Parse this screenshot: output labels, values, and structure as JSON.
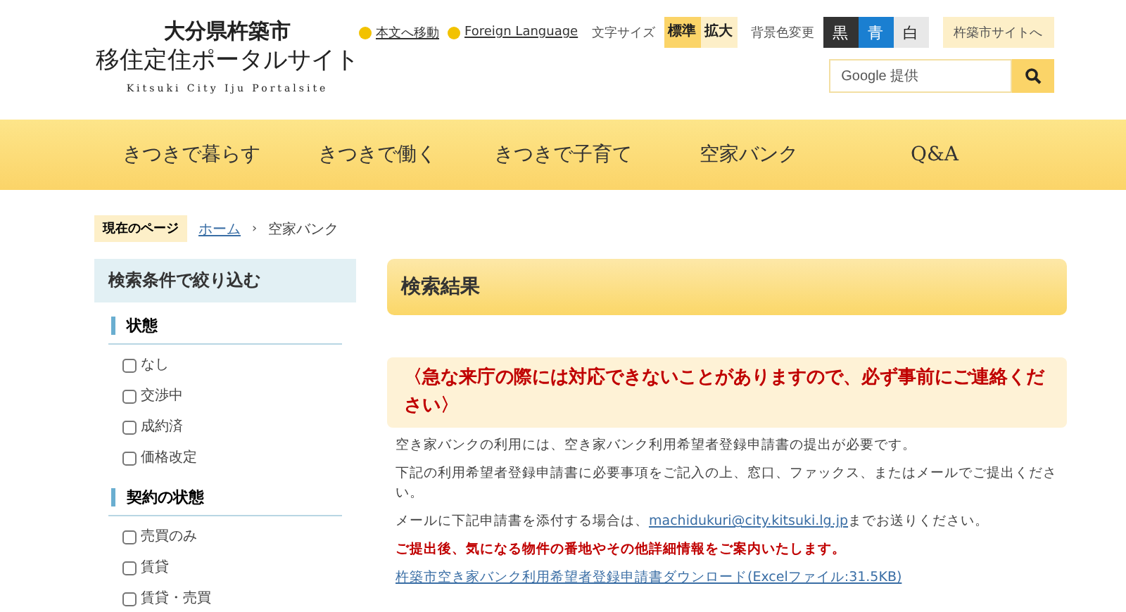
{
  "logo": {
    "prefecture": "大分県杵築市",
    "title": "移住定住ポータルサイト",
    "subtitle": "Kitsuki City Iju Portalsite"
  },
  "utility_links": [
    "本文へ移動",
    "Foreign Language"
  ],
  "font_size": {
    "label": "文字サイズ",
    "options": [
      {
        "label": "標準",
        "selected": true
      },
      {
        "label": "拡大",
        "selected": false
      }
    ]
  },
  "background_color": {
    "label": "背景色変更",
    "options": [
      {
        "label": "黒",
        "color": "#333333"
      },
      {
        "label": "青",
        "color": "#1a7fd1"
      },
      {
        "label": "白",
        "color": "#e8e8e8"
      }
    ]
  },
  "city_site_button": "杵築市サイトへ",
  "search": {
    "placeholder": "Google 提供"
  },
  "nav": [
    "きつきで暮らす",
    "きつきで働く",
    "きつきで子育て",
    "空家バンク",
    "Q&A"
  ],
  "breadcrumb": {
    "label": "現在のページ",
    "separator": "›",
    "items": [
      {
        "text": "ホーム",
        "link": true
      },
      {
        "text": "空家バンク",
        "link": false
      }
    ]
  },
  "sidebar": {
    "title": "検索条件で絞り込む",
    "groups": [
      {
        "title": "状態",
        "options": [
          {
            "label": "なし",
            "checked": false
          },
          {
            "label": "交渉中",
            "checked": false
          },
          {
            "label": "成約済",
            "checked": false
          },
          {
            "label": "価格改定",
            "checked": false
          }
        ]
      },
      {
        "title": "契約の状態",
        "options": [
          {
            "label": "売買のみ",
            "checked": false
          },
          {
            "label": "賃貸",
            "checked": false
          },
          {
            "label": "賃貸・売買",
            "checked": false
          }
        ]
      }
    ]
  },
  "main": {
    "title": "検索結果",
    "notice": "〈急な来庁の際には対応できないことがありますので、必ず事前にご連絡ください〉",
    "paragraphs": [
      {
        "kind": "text",
        "text": "空き家バンクの利用には、空き家バンク利用希望者登録申請書の提出が必要です。"
      },
      {
        "kind": "text",
        "text": "下記の利用希望者登録申請書に必要事項をご記入の上、窓口、ファックス、またはメールでご提出ください。"
      },
      {
        "kind": "mail",
        "before": "メールに下記申請書を添付する場合は、",
        "link": "machidukuri@city.kitsuki.lg.jp",
        "after": "までお送りください。"
      },
      {
        "kind": "alert",
        "text": "ご提出後、気になる物件の番地やその他詳細情報をご案内いたします。"
      },
      {
        "kind": "download",
        "text": "杵築市空き家バンク利用希望者登録申請書ダウンロード(Excelファイル:31.5KB)"
      }
    ]
  }
}
